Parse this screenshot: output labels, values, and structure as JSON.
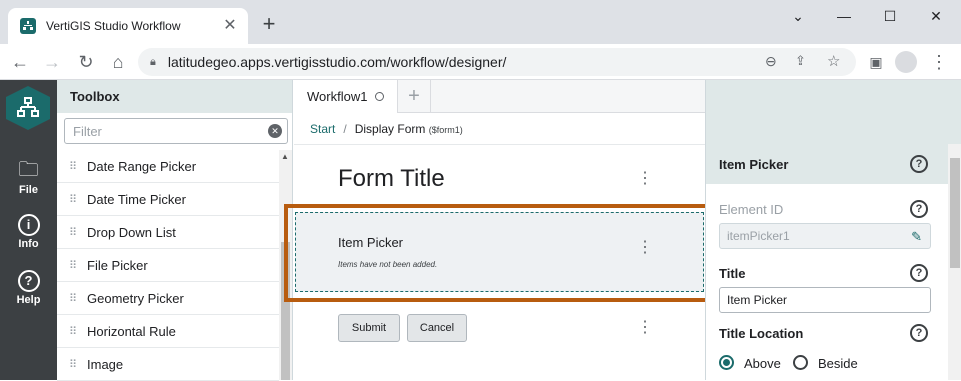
{
  "browser": {
    "tab_title": "VertiGIS Studio Workflow",
    "tab_close": "✕",
    "new_tab": "+",
    "url": "latitudegeo.apps.vertigisstudio.com/workflow/designer/",
    "controls": {
      "minimize": "⌄",
      "min": "—",
      "max": "☐",
      "close": "✕"
    }
  },
  "rail": {
    "items": [
      {
        "label": "File",
        "icon": "folder-icon"
      },
      {
        "label": "Info",
        "icon": "info-icon"
      },
      {
        "label": "Help",
        "icon": "help-icon"
      }
    ]
  },
  "toolbox": {
    "title": "Toolbox",
    "filter_placeholder": "Filter",
    "items": [
      "Date Range Picker",
      "Date Time Picker",
      "Drop Down List",
      "File Picker",
      "Geometry Picker",
      "Horizontal Rule",
      "Image"
    ]
  },
  "designer": {
    "tab_label": "Workflow1",
    "breadcrumb": {
      "start": "Start",
      "sep": "/",
      "current": "Display Form",
      "sub": "($form1)"
    },
    "form_title": "Form Title",
    "item_picker": {
      "title": "Item Picker",
      "empty": "Items have not been added."
    },
    "buttons": {
      "submit": "Submit",
      "cancel": "Cancel"
    }
  },
  "properties": {
    "header": "Item Picker",
    "element_id_label": "Element ID",
    "element_id_value": "itemPicker1",
    "title_label": "Title",
    "title_value": "Item Picker",
    "title_location_label": "Title Location",
    "options": {
      "above": "Above",
      "beside": "Beside"
    },
    "selected": "Above"
  },
  "colors": {
    "accent": "#1b6b6b",
    "highlight_border": "#b85c0f"
  }
}
